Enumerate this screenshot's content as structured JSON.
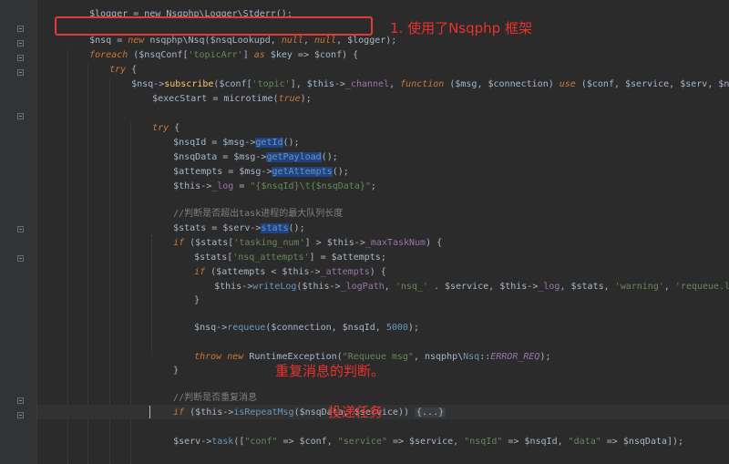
{
  "code": {
    "line0_partial": "$logger = new Nsqphp\\Logger\\Stderr();",
    "line1": {
      "var": "$nsq",
      "eq": " = ",
      "kw": "new",
      "cls": " nsqphp\\Nsq(",
      "arg1": "$nsqLookupd",
      "comma1": ", ",
      "null1": "null",
      "comma2": ", ",
      "null2": "null",
      "comma3": ", ",
      "arg4": "$logger",
      "end": ");"
    },
    "line2": {
      "kw": "foreach",
      "a": " ($nsqConf[",
      "key": "'topicArr'",
      "b": "] ",
      "as": "as",
      "c": " $key => $conf) {"
    },
    "line3": {
      "kw": "try",
      "a": " {"
    },
    "line4": {
      "a": "$nsq->",
      "fn": "subscribe",
      "b": "($conf[",
      "key": "'topic'",
      "c": "], $this->",
      "prop": "_channel",
      "d": ", ",
      "kw": "function",
      "e": " ($msg, $connection) ",
      "use": "use",
      "f": " ($conf, $service, $serv, $nsq) {"
    },
    "line5": {
      "a": "$execStart = microtime(",
      "kw": "true",
      "b": ");"
    },
    "line6": {
      "kw": "try",
      "a": " {"
    },
    "line7": {
      "a": "$nsqId = $msg->",
      "fn": "getId",
      "b": "();"
    },
    "line8": {
      "a": "$nsqData = $msg->",
      "fn": "getPayload",
      "b": "();"
    },
    "line9": {
      "a": "$attempts = $msg->",
      "fn": "getAttempts",
      "b": "();"
    },
    "line10": {
      "a": "$this->",
      "prop": "_log",
      "b": " = ",
      "str": "\"{$nsqId}\\t{$nsqData}\"",
      "c": ";"
    },
    "line11": {
      "cmt": "//判断是否超出task进程的最大队列长度"
    },
    "line12": {
      "a": "$stats = $serv->",
      "fn": "stats",
      "b": "();"
    },
    "line13": {
      "kw": "if",
      "a": " ($stats[",
      "key": "'tasking_num'",
      "b": "] > $this->",
      "prop": "_maxTaskNum",
      "c": ") {"
    },
    "line14": {
      "a": "$stats[",
      "key": "'nsq_attempts'",
      "b": "] = $attempts;"
    },
    "line15": {
      "kw": "if",
      "a": " ($attempts < $this->",
      "prop": "_attempts",
      "b": ") {"
    },
    "line16": {
      "a": "$this->",
      "fn": "writeLog",
      "b": "($this->",
      "prop1": "_logPath",
      "c": ", ",
      "str1": "'nsq_'",
      "d": " . $service, $this->",
      "prop2": "_log",
      "e": ", $stats, ",
      "str2": "'warning'",
      "f": ", ",
      "str3": "'requeue.log'",
      "g": ");"
    },
    "line17": {
      "a": "}"
    },
    "line18": {
      "a": "$nsq->",
      "fn": "requeue",
      "b": "($connection, $nsqId, ",
      "num": "5000",
      "c": ");"
    },
    "line19": {
      "kw1": "throw",
      "sp": " ",
      "kw2": "new",
      "a": " RuntimeException(",
      "str": "\"Requeue msg\"",
      "b": ", nsqphp\\",
      "cls": "Nsq",
      "c": "::",
      "const": "ERROR_REQ",
      "d": ");"
    },
    "line20": {
      "a": "}"
    },
    "line21": {
      "cmt": "//判断是否重复消息"
    },
    "line22": {
      "kw": "if",
      "a": " ($this->",
      "fn": "isRepeatMsg",
      "b": "($nsqData, $service)) ",
      "fold": "{...}"
    },
    "line24": {
      "a": "$serv->",
      "fn": "task",
      "b": "([",
      "s1": "\"conf\"",
      "c": " => $conf, ",
      "s2": "\"service\"",
      "d": " => $service, ",
      "s3": "\"nsqId\"",
      "e": " => $nsqId, ",
      "s4": "\"data\"",
      "f": " => $nsqData]);"
    }
  },
  "annotations": {
    "label1": "1. 使用了Nsqphp 框架",
    "label2": "重复消息的判断。",
    "label3": "投递任务"
  },
  "colors": {
    "background": "#2b2b2b",
    "keyword": "#cc7832",
    "string": "#6a8759",
    "function": "#ffc66d",
    "property": "#9876aa",
    "comment": "#808080",
    "number": "#6897bb",
    "annotation": "#e8322e"
  }
}
